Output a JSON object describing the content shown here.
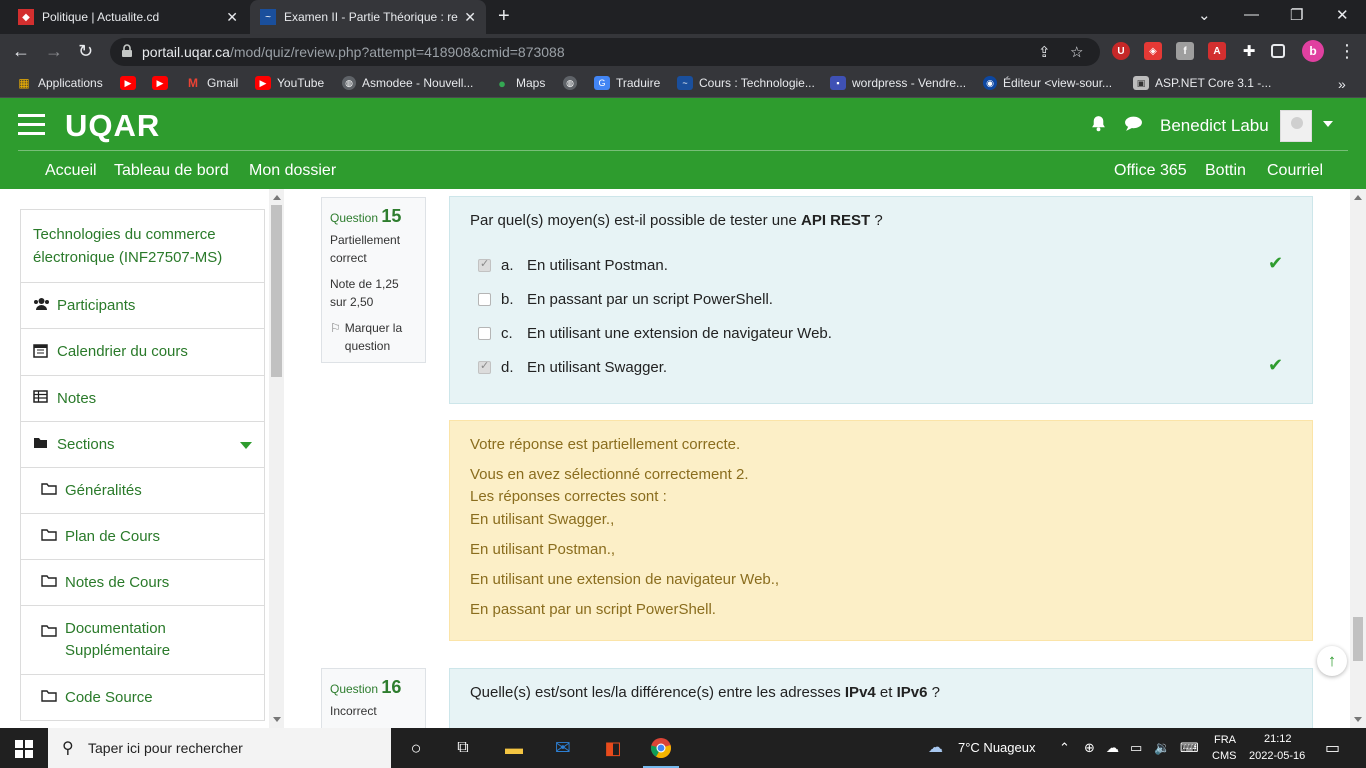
{
  "browser": {
    "tabs": [
      {
        "title": "Politique | Actualite.cd",
        "close": "✕"
      },
      {
        "title": "Examen II - Partie Théorique : relecture de tentative",
        "close": "✕"
      }
    ],
    "new_tab": "+",
    "url_host": "portail.uqar.ca",
    "url_path": "/mod/quiz/review.php?attempt=418908&cmid=873088",
    "profile_letter": "b",
    "bookmarks": [
      "Applications",
      "Gmail",
      "YouTube",
      "Asmodee - Nouvell...",
      "Maps",
      "Traduire",
      "Cours : Technologie...",
      "wordpress - Vendre...",
      "Éditeur <view-sour...",
      "ASP.NET Core 3.1 -..."
    ],
    "bookmarks_more": "»"
  },
  "site": {
    "logo": "UQAR",
    "user_name": "Benedict Labu",
    "menu_left": [
      "Accueil",
      "Tableau de bord",
      "Mon dossier"
    ],
    "menu_right": [
      "Office 365",
      "Bottin",
      "Courriel"
    ]
  },
  "drawer": {
    "course": "Technologies du commerce électronique (INF27507-MS)",
    "items": [
      "Participants",
      "Calendrier du cours",
      "Notes",
      "Sections"
    ],
    "sections": [
      "Généralités",
      "Plan de Cours",
      "Notes de Cours",
      "Documentation Supplémentaire",
      "Code Source"
    ]
  },
  "q15": {
    "label": "Question",
    "number": "15",
    "state": "Partiellement correct",
    "grade": "Note de 1,25 sur 2,50",
    "flag": "Marquer la question",
    "text_before": "Par quel(s) moyen(s) est-il possible de tester une ",
    "text_bold": "API REST",
    "text_after": " ?",
    "answers": [
      {
        "letter": "a.",
        "text": "En utilisant Postman.",
        "checked": true,
        "correct": true
      },
      {
        "letter": "b.",
        "text": "En passant par un script PowerShell.",
        "checked": false,
        "correct": false
      },
      {
        "letter": "c.",
        "text": "En utilisant une extension de navigateur Web.",
        "checked": false,
        "correct": false
      },
      {
        "letter": "d.",
        "text": "En utilisant Swagger.",
        "checked": true,
        "correct": true
      }
    ],
    "feedback": {
      "line1": "Votre réponse est partiellement correcte.",
      "line2": "Vous en avez sélectionné correctement 2.",
      "line3": "Les réponses correctes sont :",
      "line4": "En utilisant Swagger.,",
      "line5": "En utilisant Postman.,",
      "line6": "En utilisant une extension de navigateur Web.,",
      "line7": "En passant par un script PowerShell."
    }
  },
  "q16": {
    "label": "Question",
    "number": "16",
    "state": "Incorrect",
    "text_before": "Quelle(s) est/sont les/la différence(s) entre les adresses ",
    "bold1": "IPv4",
    "mid": " et ",
    "bold2": "IPv6",
    "text_after": " ?"
  },
  "taskbar": {
    "search_placeholder": "Taper ici pour rechercher",
    "weather": "7°C  Nuageux",
    "lang": "FRA",
    "lang2": "CMS",
    "time": "21:12",
    "date": "2022-05-16"
  },
  "colors": {
    "uqar_green": "#2e9c2e",
    "question_bg": "#e7f3f5",
    "feedback_bg": "#fcefc7"
  }
}
